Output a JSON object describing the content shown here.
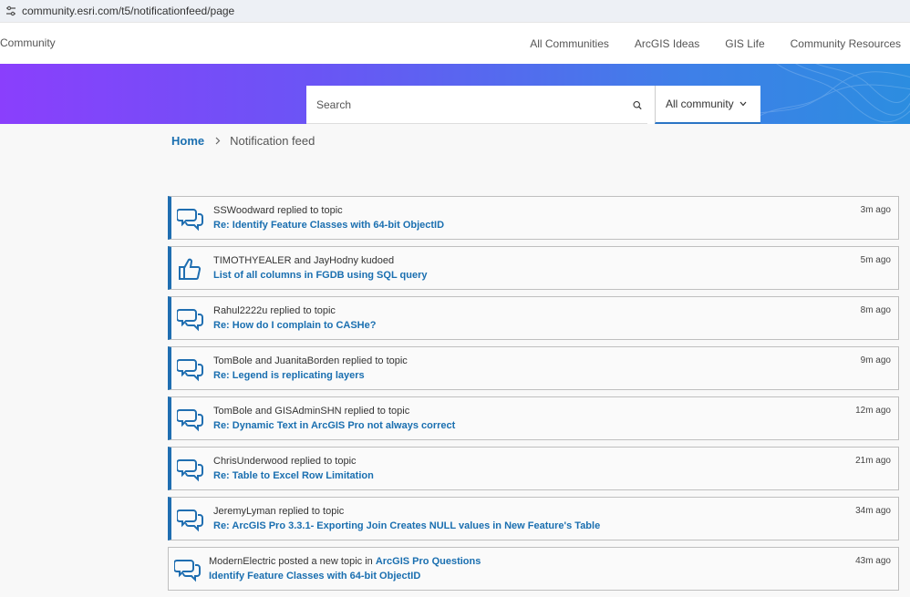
{
  "browser": {
    "url": "community.esri.com/t5/notificationfeed/page"
  },
  "header": {
    "brand": "Community",
    "nav": [
      "All Communities",
      "ArcGIS Ideas",
      "GIS Life",
      "Community Resources"
    ]
  },
  "search": {
    "placeholder": "Search",
    "scope": "All community"
  },
  "breadcrumb": {
    "home": "Home",
    "current": "Notification feed"
  },
  "feed": [
    {
      "icon": "reply",
      "actor": "SSWoodward replied to topic",
      "link": "Re: Identify Feature Classes with 64-bit ObjectID",
      "time": "3m ago"
    },
    {
      "icon": "kudo",
      "actor": "TIMOTHYEALER and JayHodny kudoed",
      "link": "List of all columns in FGDB using SQL query",
      "time": "5m ago"
    },
    {
      "icon": "reply",
      "actor": "Rahul2222u replied to topic",
      "link": "Re: How do I complain to CASHe?",
      "time": "8m ago"
    },
    {
      "icon": "reply",
      "actor": "TomBole and JuanitaBorden replied to topic",
      "link": "Re: Legend is replicating layers",
      "time": "9m ago"
    },
    {
      "icon": "reply",
      "actor": "TomBole and GISAdminSHN replied to topic",
      "link": "Re: Dynamic Text in ArcGIS Pro not always correct",
      "time": "12m ago"
    },
    {
      "icon": "reply",
      "actor": "ChrisUnderwood replied to topic",
      "link": "Re: Table to Excel Row Limitation",
      "time": "21m ago"
    },
    {
      "icon": "reply",
      "actor": "JeremyLyman replied to topic",
      "link": "Re: ArcGIS Pro 3.3.1- Exporting Join Creates NULL values in New Feature's Table",
      "time": "34m ago"
    },
    {
      "icon": "reply",
      "actor": "ModernElectric posted a new topic in",
      "location": "ArcGIS Pro Questions",
      "link": "Identify Feature Classes with 64-bit ObjectID",
      "time": "43m ago",
      "new": true
    }
  ],
  "colors": {
    "accent": "#1f6eb1",
    "link": "#1a6fb0"
  }
}
